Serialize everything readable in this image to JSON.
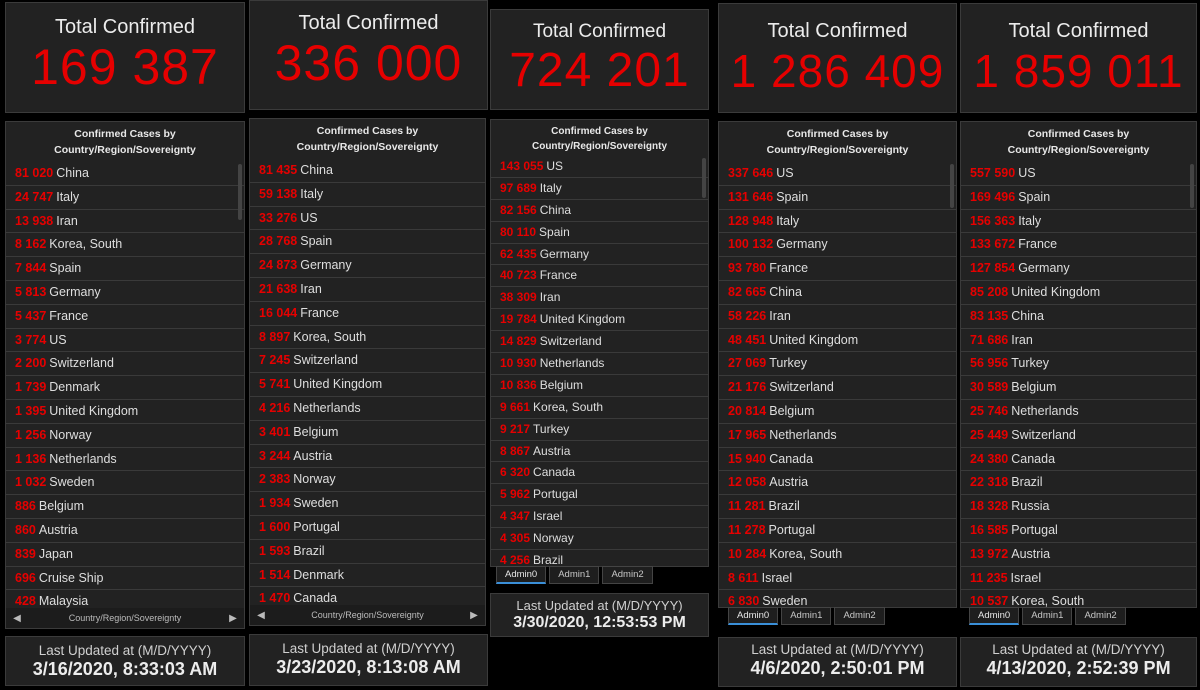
{
  "panels": [
    {
      "total_label": "Total Confirmed",
      "total_value": "169 387",
      "list_title": "Confirmed Cases by Country/Region/Sovereignty",
      "items": [
        {
          "count": "81 020",
          "name": "China"
        },
        {
          "count": "24 747",
          "name": "Italy"
        },
        {
          "count": "13 938",
          "name": "Iran"
        },
        {
          "count": "8 162",
          "name": "Korea, South"
        },
        {
          "count": "7 844",
          "name": "Spain"
        },
        {
          "count": "5 813",
          "name": "Germany"
        },
        {
          "count": "5 437",
          "name": "France"
        },
        {
          "count": "3 774",
          "name": "US"
        },
        {
          "count": "2 200",
          "name": "Switzerland"
        },
        {
          "count": "1 739",
          "name": "Denmark"
        },
        {
          "count": "1 395",
          "name": "United Kingdom"
        },
        {
          "count": "1 256",
          "name": "Norway"
        },
        {
          "count": "1 136",
          "name": "Netherlands"
        },
        {
          "count": "1 032",
          "name": "Sweden"
        },
        {
          "count": "886",
          "name": "Belgium"
        },
        {
          "count": "860",
          "name": "Austria"
        },
        {
          "count": "839",
          "name": "Japan"
        },
        {
          "count": "696",
          "name": "Cruise Ship"
        },
        {
          "count": "428",
          "name": "Malaysia"
        }
      ],
      "footer_bar_label": "Country/Region/Sovereignty",
      "updated_label": "Last Updated at (M/D/YYYY)",
      "updated_value": "3/16/2020, 8:33:03 AM"
    },
    {
      "total_label": "Total Confirmed",
      "total_value": "336 000",
      "list_title": "Confirmed Cases by Country/Region/Sovereignty",
      "items": [
        {
          "count": "81 435",
          "name": "China"
        },
        {
          "count": "59 138",
          "name": "Italy"
        },
        {
          "count": "33 276",
          "name": "US"
        },
        {
          "count": "28 768",
          "name": "Spain"
        },
        {
          "count": "24 873",
          "name": "Germany"
        },
        {
          "count": "21 638",
          "name": "Iran"
        },
        {
          "count": "16 044",
          "name": "France"
        },
        {
          "count": "8 897",
          "name": "Korea, South"
        },
        {
          "count": "7 245",
          "name": "Switzerland"
        },
        {
          "count": "5 741",
          "name": "United Kingdom"
        },
        {
          "count": "4 216",
          "name": "Netherlands"
        },
        {
          "count": "3 401",
          "name": "Belgium"
        },
        {
          "count": "3 244",
          "name": "Austria"
        },
        {
          "count": "2 383",
          "name": "Norway"
        },
        {
          "count": "1 934",
          "name": "Sweden"
        },
        {
          "count": "1 600",
          "name": "Portugal"
        },
        {
          "count": "1 593",
          "name": "Brazil"
        },
        {
          "count": "1 514",
          "name": "Denmark"
        },
        {
          "count": "1 470",
          "name": "Canada"
        }
      ],
      "footer_bar_label": "Country/Region/Sovereignty",
      "updated_label": "Last Updated at (M/D/YYYY)",
      "updated_value": "3/23/2020, 8:13:08 AM"
    },
    {
      "total_label": "Total Confirmed",
      "total_value": "724 201",
      "list_title": "Confirmed Cases by Country/Region/Sovereignty",
      "items": [
        {
          "count": "143 055",
          "name": "US"
        },
        {
          "count": "97 689",
          "name": "Italy"
        },
        {
          "count": "82 156",
          "name": "China"
        },
        {
          "count": "80 110",
          "name": "Spain"
        },
        {
          "count": "62 435",
          "name": "Germany"
        },
        {
          "count": "40 723",
          "name": "France"
        },
        {
          "count": "38 309",
          "name": "Iran"
        },
        {
          "count": "19 784",
          "name": "United Kingdom"
        },
        {
          "count": "14 829",
          "name": "Switzerland"
        },
        {
          "count": "10 930",
          "name": "Netherlands"
        },
        {
          "count": "10 836",
          "name": "Belgium"
        },
        {
          "count": "9 661",
          "name": "Korea, South"
        },
        {
          "count": "9 217",
          "name": "Turkey"
        },
        {
          "count": "8 867",
          "name": "Austria"
        },
        {
          "count": "6 320",
          "name": "Canada"
        },
        {
          "count": "5 962",
          "name": "Portugal"
        },
        {
          "count": "4 347",
          "name": "Israel"
        },
        {
          "count": "4 305",
          "name": "Norway"
        },
        {
          "count": "4 256",
          "name": "Brazil"
        }
      ],
      "tabs": [
        "Admin0",
        "Admin1",
        "Admin2"
      ],
      "updated_label": "Last Updated at (M/D/YYYY)",
      "updated_value": "3/30/2020, 12:53:53 PM"
    },
    {
      "total_label": "Total Confirmed",
      "total_value": "1 286 409",
      "list_title": "Confirmed Cases by Country/Region/Sovereignty",
      "items": [
        {
          "count": "337 646",
          "name": "US"
        },
        {
          "count": "131 646",
          "name": "Spain"
        },
        {
          "count": "128 948",
          "name": "Italy"
        },
        {
          "count": "100 132",
          "name": "Germany"
        },
        {
          "count": "93 780",
          "name": "France"
        },
        {
          "count": "82 665",
          "name": "China"
        },
        {
          "count": "58 226",
          "name": "Iran"
        },
        {
          "count": "48 451",
          "name": "United Kingdom"
        },
        {
          "count": "27 069",
          "name": "Turkey"
        },
        {
          "count": "21 176",
          "name": "Switzerland"
        },
        {
          "count": "20 814",
          "name": "Belgium"
        },
        {
          "count": "17 965",
          "name": "Netherlands"
        },
        {
          "count": "15 940",
          "name": "Canada"
        },
        {
          "count": "12 058",
          "name": "Austria"
        },
        {
          "count": "11 281",
          "name": "Brazil"
        },
        {
          "count": "11 278",
          "name": "Portugal"
        },
        {
          "count": "10 284",
          "name": "Korea, South"
        },
        {
          "count": "8 611",
          "name": "Israel"
        },
        {
          "count": "6 830",
          "name": "Sweden"
        }
      ],
      "tabs": [
        "Admin0",
        "Admin1",
        "Admin2"
      ],
      "updated_label": "Last Updated at (M/D/YYYY)",
      "updated_value": "4/6/2020, 2:50:01 PM"
    },
    {
      "total_label": "Total Confirmed",
      "total_value": "1 859 011",
      "list_title": "Confirmed Cases by Country/Region/Sovereignty",
      "items": [
        {
          "count": "557 590",
          "name": "US"
        },
        {
          "count": "169 496",
          "name": "Spain"
        },
        {
          "count": "156 363",
          "name": "Italy"
        },
        {
          "count": "133 672",
          "name": "France"
        },
        {
          "count": "127 854",
          "name": "Germany"
        },
        {
          "count": "85 208",
          "name": "United Kingdom"
        },
        {
          "count": "83 135",
          "name": "China"
        },
        {
          "count": "71 686",
          "name": "Iran"
        },
        {
          "count": "56 956",
          "name": "Turkey"
        },
        {
          "count": "30 589",
          "name": "Belgium"
        },
        {
          "count": "25 746",
          "name": "Netherlands"
        },
        {
          "count": "25 449",
          "name": "Switzerland"
        },
        {
          "count": "24 380",
          "name": "Canada"
        },
        {
          "count": "22 318",
          "name": "Brazil"
        },
        {
          "count": "18 328",
          "name": "Russia"
        },
        {
          "count": "16 585",
          "name": "Portugal"
        },
        {
          "count": "13 972",
          "name": "Austria"
        },
        {
          "count": "11 235",
          "name": "Israel"
        },
        {
          "count": "10 537",
          "name": "Korea, South"
        }
      ],
      "tabs": [
        "Admin0",
        "Admin1",
        "Admin2"
      ],
      "updated_label": "Last Updated at (M/D/YYYY)",
      "updated_value": "4/13/2020, 2:52:39 PM"
    }
  ]
}
